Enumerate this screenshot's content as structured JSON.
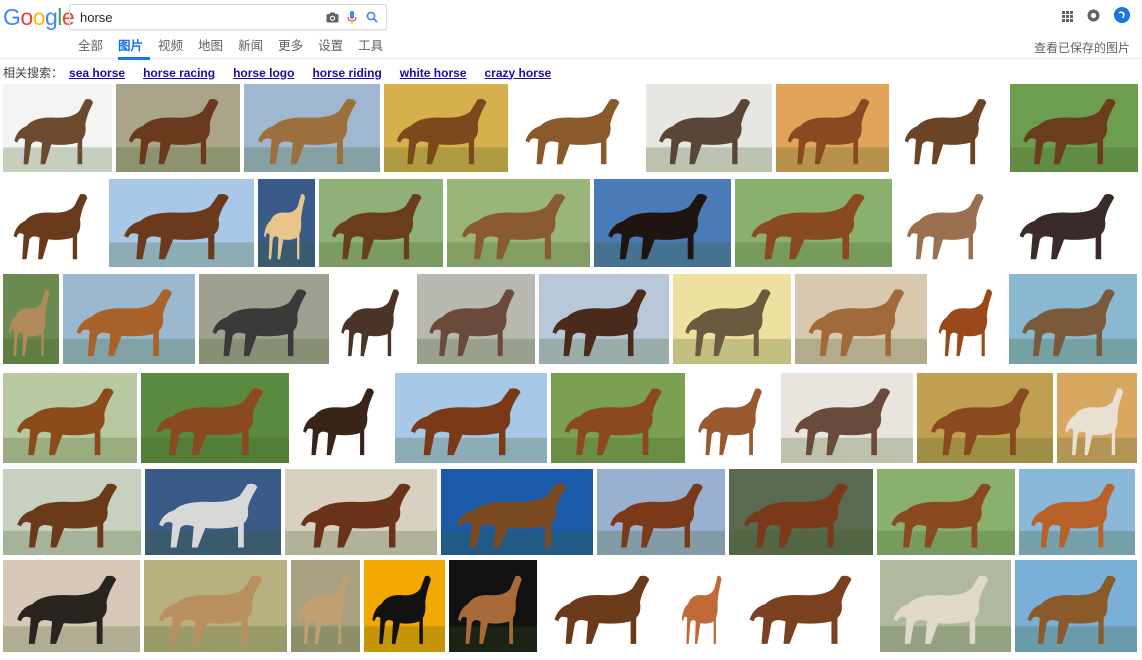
{
  "logo": {
    "letters": [
      "G",
      "o",
      "o",
      "g",
      "l",
      "e"
    ],
    "colors": [
      "#4285f4",
      "#ea4335",
      "#fbbc05",
      "#4285f4",
      "#34a853",
      "#ea4335"
    ]
  },
  "search": {
    "value": "horse"
  },
  "icons": {
    "camera": "camera-icon",
    "mic": "mic-icon",
    "search": "search-icon",
    "apps": "apps-grid-icon",
    "notifications": "notifications-icon",
    "account": "account-icon"
  },
  "nav": {
    "tabs": [
      {
        "label": "全部",
        "active": false
      },
      {
        "label": "图片",
        "active": true
      },
      {
        "label": "视频",
        "active": false
      },
      {
        "label": "地图",
        "active": false
      },
      {
        "label": "新闻",
        "active": false
      },
      {
        "label": "更多",
        "active": false
      },
      {
        "label": "设置",
        "active": false
      },
      {
        "label": "工具",
        "active": false
      }
    ],
    "saved_images": "查看已保存的图片"
  },
  "related": {
    "label": "相关搜索：",
    "links": [
      {
        "pre": "sea",
        "rest": " horse"
      },
      {
        "pre": "",
        "rest": "horse racing"
      },
      {
        "pre": "",
        "rest": "horse logo"
      },
      {
        "pre": "",
        "rest": "horse riding"
      },
      {
        "pre": "white",
        "rest": " horse"
      },
      {
        "pre": "crazy",
        "rest": " horse"
      }
    ]
  },
  "colors": {
    "accent": "#1a73e8",
    "link": "#1a0dab"
  },
  "results": [
    [
      {
        "bg": "#f4f4f2",
        "fg": "#6b4a2f"
      },
      {
        "bg": "#a9a48a",
        "fg": "#6b3a1d"
      },
      {
        "bg": "#9fb8cf",
        "fg": "#9c6f3e"
      },
      {
        "bg": "#d6b04d",
        "fg": "#7a4a1c"
      },
      {
        "bg": "#ffffff",
        "fg": "#8a5a2c"
      },
      {
        "bg": "#e8e6e2",
        "fg": "#5a4636"
      },
      {
        "bg": "#e1a458",
        "fg": "#8a4a1f"
      },
      {
        "bg": "#ffffff",
        "fg": "#6a4424"
      },
      {
        "bg": "#6d9e4f",
        "fg": "#6a3d1e"
      }
    ],
    [
      {
        "bg": "#ffffff",
        "fg": "#6a3a1c"
      },
      {
        "bg": "#a9c8e8",
        "fg": "#6b3a1d"
      },
      {
        "bg": "#3a5a8a",
        "fg": "#e8c58a"
      },
      {
        "bg": "#8fb078",
        "fg": "#6a3d1e"
      },
      {
        "bg": "#9ab57a",
        "fg": "#8a5a30"
      },
      {
        "bg": "#4a7ab8",
        "fg": "#1e1410"
      },
      {
        "bg": "#8ab070",
        "fg": "#8a4a20"
      },
      {
        "bg": "#ffffff",
        "fg": "#9a7050"
      },
      {
        "bg": "#ffffff",
        "fg": "#3a2a2a"
      }
    ],
    [
      {
        "bg": "#6a8a50",
        "fg": "#b08a5a"
      },
      {
        "bg": "#9ab8d0",
        "fg": "#a8622a"
      },
      {
        "bg": "#a0a090",
        "fg": "#3a3a3a"
      },
      {
        "bg": "#ffffff",
        "fg": "#4a3428"
      },
      {
        "bg": "#b8b8b0",
        "fg": "#6a4a3a"
      },
      {
        "bg": "#b8c8d8",
        "fg": "#4a2a1a"
      },
      {
        "bg": "#f0e0a0",
        "fg": "#6a5a40"
      },
      {
        "bg": "#d8c8b0",
        "fg": "#a06a3a"
      },
      {
        "bg": "#ffffff",
        "fg": "#9a4a1a"
      },
      {
        "bg": "#8ab8d0",
        "fg": "#7a5a3a"
      }
    ],
    [
      {
        "bg": "#b8c8a0",
        "fg": "#8a4a1a"
      },
      {
        "bg": "#5a8a40",
        "fg": "#8a4a20"
      },
      {
        "bg": "#ffffff",
        "fg": "#3a2418"
      },
      {
        "bg": "#a8c8e8",
        "fg": "#7a3a18"
      },
      {
        "bg": "#7aa050",
        "fg": "#8a4a1e"
      },
      {
        "bg": "#ffffff",
        "fg": "#9a5a30"
      },
      {
        "bg": "#e8e4de",
        "fg": "#6a4a3a"
      },
      {
        "bg": "#c0a050",
        "fg": "#8a4a20"
      },
      {
        "bg": "#d8a860",
        "fg": "#e8e0d0"
      }
    ],
    [
      {
        "bg": "#c8d0c0",
        "fg": "#6a3a1a"
      },
      {
        "bg": "#3a5a88",
        "fg": "#d8d8d8"
      },
      {
        "bg": "#d8d0c0",
        "fg": "#6a3218"
      },
      {
        "bg": "#1a5aa8",
        "fg": "#7a4a22"
      },
      {
        "bg": "#9ab0d0",
        "fg": "#7a3a1a"
      },
      {
        "bg": "#5a6a50",
        "fg": "#7a3a1a"
      },
      {
        "bg": "#8ab070",
        "fg": "#8a4a20"
      },
      {
        "bg": "#8ab8d8",
        "fg": "#b8622a"
      }
    ],
    [
      {
        "bg": "#d8c8b8",
        "fg": "#2a2420"
      },
      {
        "bg": "#b8b080",
        "fg": "#b89060"
      },
      {
        "bg": "#a8a080",
        "fg": "#c0a070"
      },
      {
        "bg": "#f2a800",
        "fg": "#111111"
      },
      {
        "bg": "#111111",
        "fg": "#a86a38"
      },
      {
        "bg": "#ffffff",
        "fg": "#6a3a1a"
      },
      {
        "bg": "#ffffff",
        "fg": "#c06a3a"
      },
      {
        "bg": "#ffffff",
        "fg": "#7a4020"
      },
      {
        "bg": "#b0b8a0",
        "fg": "#e0d8c8"
      },
      {
        "bg": "#7ab0d8",
        "fg": "#8a5a2a"
      }
    ]
  ]
}
